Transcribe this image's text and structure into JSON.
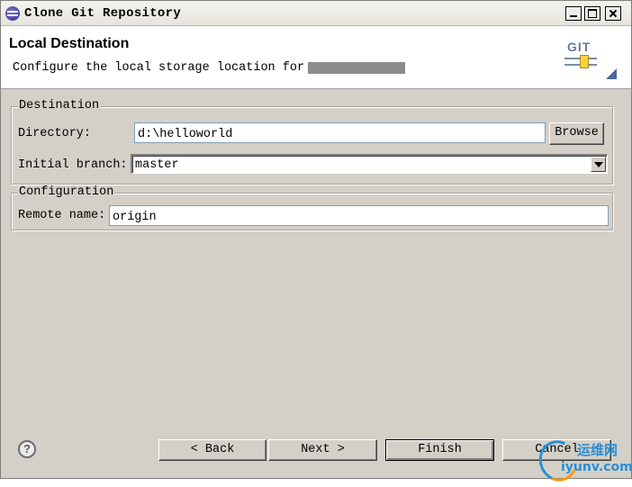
{
  "window": {
    "title": "Clone Git Repository",
    "icons": {
      "app": "eclipse-icon",
      "minimize": "minimize-icon",
      "maximize": "maximize-icon",
      "close": "close-icon"
    }
  },
  "header": {
    "title": "Local Destination",
    "description": "Configure the local storage location for",
    "logo": "GIT"
  },
  "destination": {
    "legend": "Destination",
    "directory_label": "Directory:",
    "directory_value": "d:\\helloworld",
    "browse_label": "Browse",
    "branch_label": "Initial branch:",
    "branch_value": "master"
  },
  "configuration": {
    "legend": "Configuration",
    "remote_label": "Remote name:",
    "remote_value": "origin"
  },
  "footer": {
    "help_glyph": "?",
    "back_label": "< Back",
    "next_label": "Next >",
    "finish_label": "Finish",
    "cancel_label": "Cancel"
  },
  "watermark": {
    "top": "运维网",
    "bottom": "iyunv.com"
  },
  "colors": {
    "dialog_bg": "#d4d0c8",
    "header_bg": "#ffffff",
    "input_border": "#7f9db9",
    "redaction": "#8c8c8c",
    "watermark": "#2a8fd6"
  }
}
